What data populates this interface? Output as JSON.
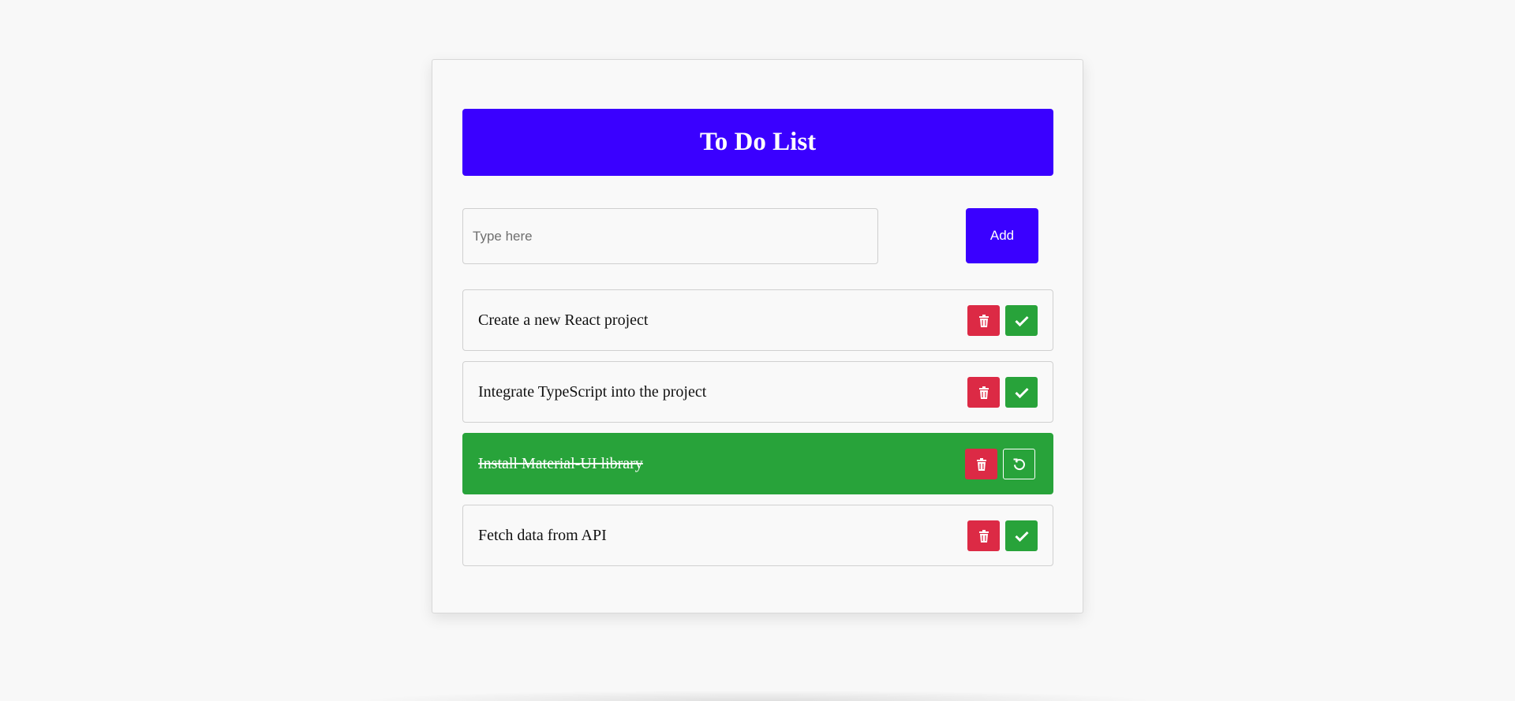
{
  "header": {
    "title": "To Do List"
  },
  "input": {
    "value": "",
    "placeholder": "Type here"
  },
  "add_button": {
    "label": "Add"
  },
  "colors": {
    "primary": "#3a00ff",
    "delete": "#dc2a45",
    "done": "#28a33a"
  },
  "tasks": [
    {
      "text": "Create a new React project",
      "completed": false,
      "icons": [
        "trash-icon",
        "check-icon"
      ]
    },
    {
      "text": "Integrate TypeScript into the project",
      "completed": false,
      "icons": [
        "trash-icon",
        "check-icon"
      ]
    },
    {
      "text": "Install Material-UI library",
      "completed": true,
      "icons": [
        "trash-icon",
        "undo-icon"
      ]
    },
    {
      "text": "Fetch data from API",
      "completed": false,
      "icons": [
        "trash-icon",
        "check-icon"
      ]
    }
  ]
}
